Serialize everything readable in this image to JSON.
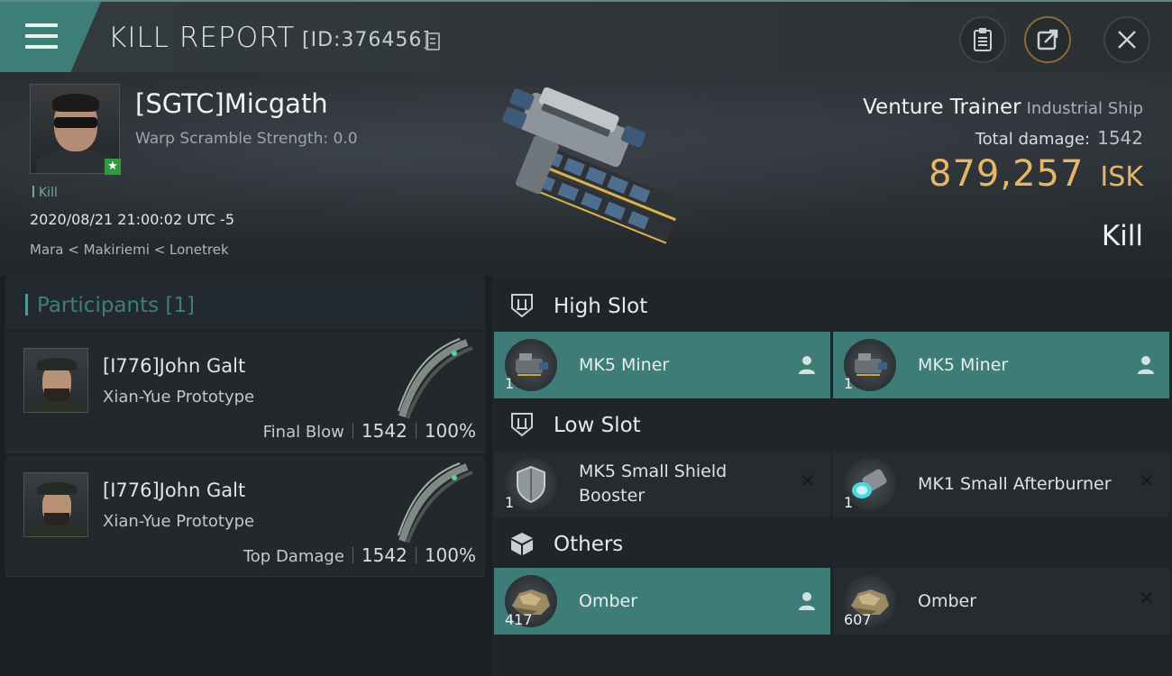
{
  "header": {
    "title": "KILL REPORT",
    "report_id": "[ID:376456]"
  },
  "victim": {
    "name": "[SGTC]Micgath",
    "warp_scramble": "Warp Scramble Strength: 0.0",
    "kill_tag": "Kill",
    "timestamp": "2020/08/21 21:00:02 UTC -5",
    "location": "Mara < Makiriemi < Lonetrek"
  },
  "ship": {
    "name": "Venture Trainer",
    "class": "Industrial Ship",
    "total_damage_label": "Total damage:",
    "total_damage_value": "1542",
    "isk_value": "879,257",
    "isk_unit": "ISK",
    "result": "Kill"
  },
  "participants": {
    "title": "Participants [1]",
    "items": [
      {
        "name": "[I776]John Galt",
        "ship": "Xian-Yue Prototype",
        "label": "Final Blow",
        "damage": "1542",
        "percent": "100%"
      },
      {
        "name": "[I776]John Galt",
        "ship": "Xian-Yue Prototype",
        "label": "Top Damage",
        "damage": "1542",
        "percent": "100%"
      }
    ]
  },
  "slots": {
    "high": {
      "title": "High Slot",
      "modules": [
        {
          "name": "MK5 Miner",
          "qty": "1",
          "status": "fitted"
        },
        {
          "name": "MK5 Miner",
          "qty": "1",
          "status": "fitted"
        }
      ]
    },
    "low": {
      "title": "Low Slot",
      "modules": [
        {
          "name": "MK5 Small Shield Booster",
          "qty": "1",
          "status": "destroyed"
        },
        {
          "name": "MK1 Small Afterburner",
          "qty": "1",
          "status": "destroyed"
        }
      ]
    },
    "others": {
      "title": "Others",
      "modules": [
        {
          "name": "Omber",
          "qty": "417",
          "status": "fitted"
        },
        {
          "name": "Omber",
          "qty": "607",
          "status": "destroyed"
        }
      ]
    }
  },
  "colors": {
    "accent_teal": "#3e7d77",
    "isk_gold": "#e6b766",
    "participants_title": "#3f7c80"
  },
  "icons": {
    "menu": "hamburger-icon",
    "copy": "copy-icon",
    "clipboard": "clipboard-icon",
    "share": "share-icon",
    "close": "close-icon",
    "fitted": "person-icon",
    "destroyed": "x-icon"
  }
}
